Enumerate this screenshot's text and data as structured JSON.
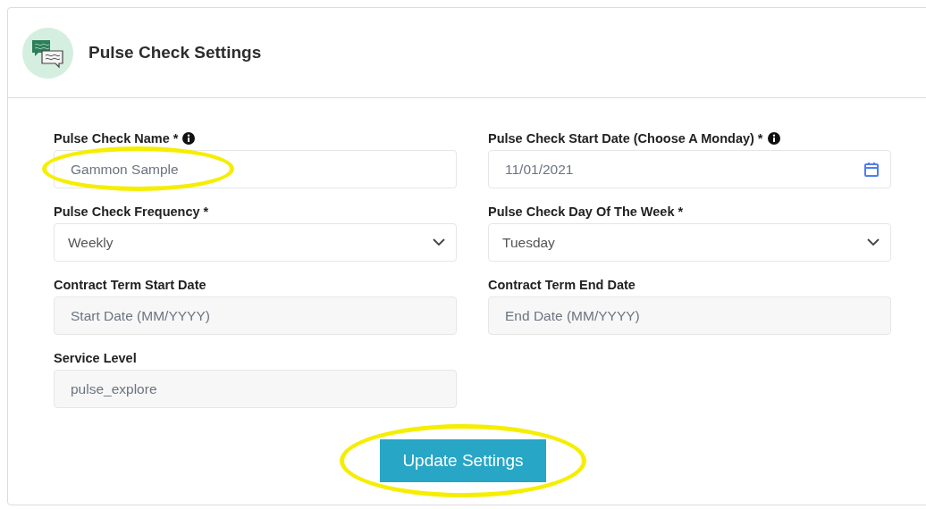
{
  "header": {
    "title": "Pulse Check Settings"
  },
  "fields": [
    {
      "kind": "text",
      "label": "Pulse Check Name *",
      "info": true,
      "value": "Gammon Sample",
      "highlighted": true
    },
    {
      "kind": "date",
      "label": "Pulse Check Start Date (Choose A Monday) *",
      "info": true,
      "value": "11/01/2021",
      "highlighted": false
    },
    {
      "kind": "select",
      "label": "Pulse Check Frequency *",
      "info": false,
      "value": "Weekly",
      "highlighted": false
    },
    {
      "kind": "select",
      "label": "Pulse Check Day Of The Week *",
      "info": false,
      "value": "Tuesday",
      "highlighted": false
    },
    {
      "kind": "disabled",
      "label": "Contract Term Start Date",
      "info": false,
      "placeholder": "Start Date (MM/YYYY)",
      "highlighted": false
    },
    {
      "kind": "disabled",
      "label": "Contract Term End Date",
      "info": false,
      "placeholder": "End Date (MM/YYYY)",
      "highlighted": false
    },
    {
      "kind": "disabled",
      "label": "Service Level",
      "info": false,
      "value": "pulse_explore",
      "highlighted": false
    }
  ],
  "submit": {
    "label": "Update Settings",
    "highlighted": true
  }
}
